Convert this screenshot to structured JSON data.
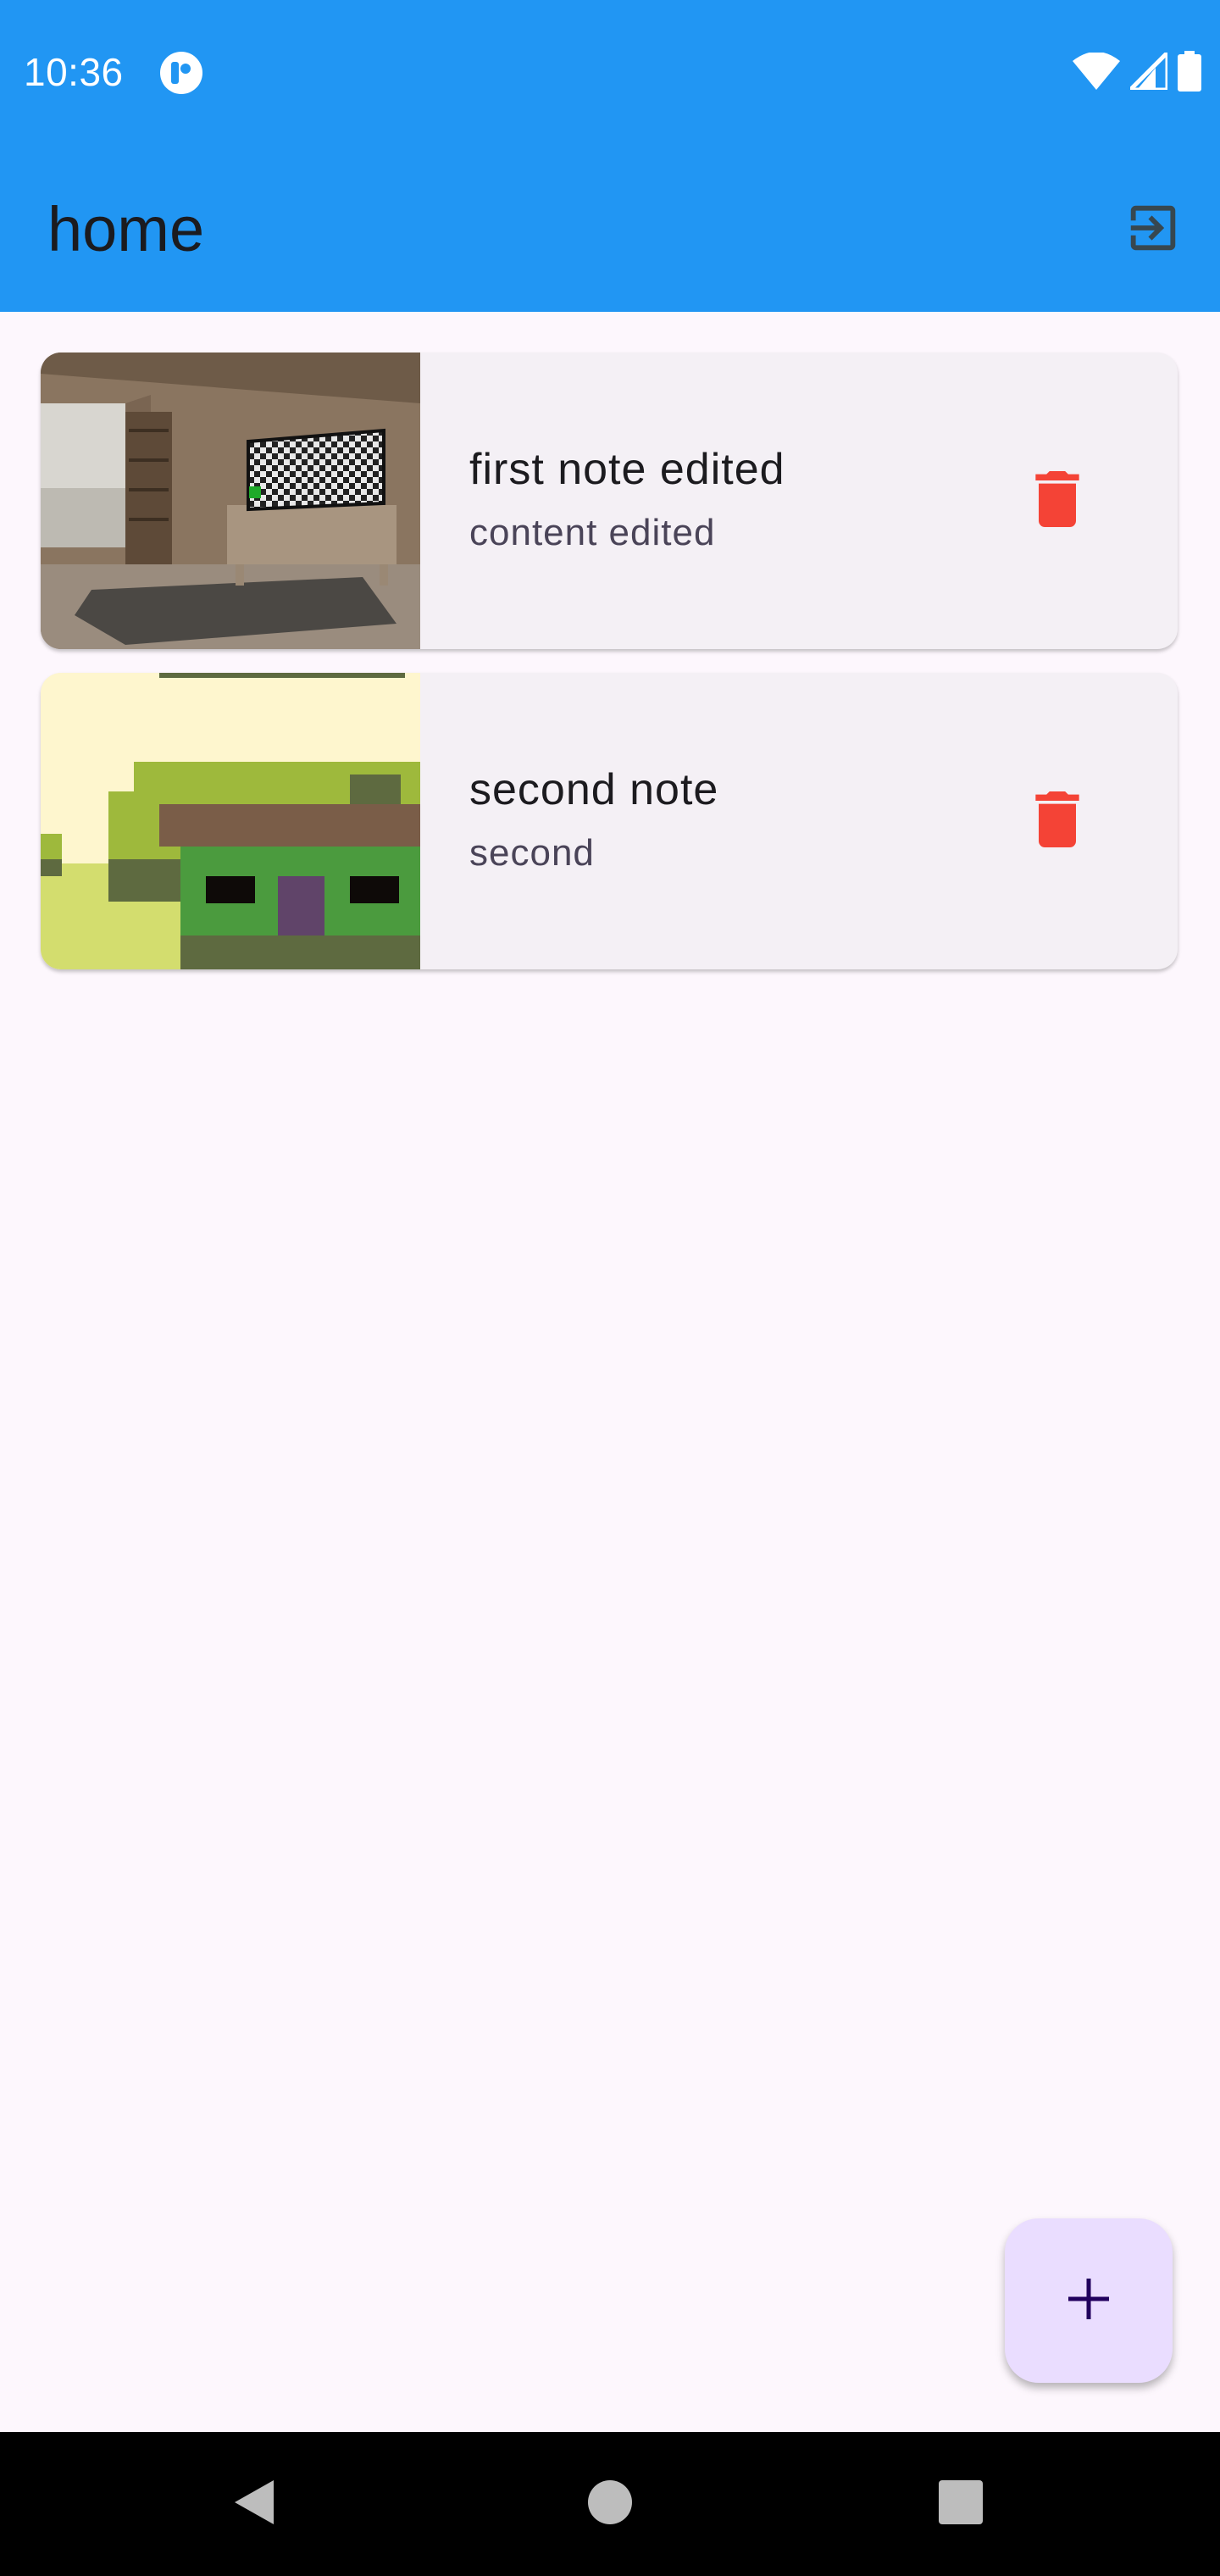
{
  "status_bar": {
    "time": "10:36",
    "icons": [
      "app-notification-icon",
      "wifi-icon",
      "signal-icon",
      "battery-icon"
    ]
  },
  "app_bar": {
    "title": "home",
    "logout_icon": "logout-icon"
  },
  "notes": [
    {
      "title": "first note edited",
      "content": "content edited",
      "thumbnail": "room-interior-image",
      "delete_icon": "trash-icon"
    },
    {
      "title": "second note",
      "content": "second",
      "thumbnail": "pixel-house-image",
      "delete_icon": "trash-icon"
    }
  ],
  "fab": {
    "icon": "plus-icon"
  },
  "nav_bar": {
    "buttons": [
      "back-icon",
      "home-icon",
      "recents-icon"
    ]
  },
  "colors": {
    "primary": "#2196F3",
    "background": "#FDF7FD",
    "card": "#F4F0F5",
    "delete": "#F44336",
    "fab": "#EADDFF",
    "fab_icon": "#21005D"
  }
}
